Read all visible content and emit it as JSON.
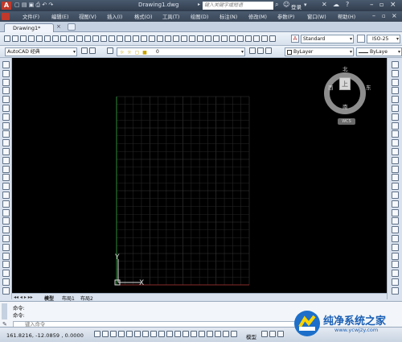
{
  "title": {
    "filename": "Drawing1.dwg",
    "search_placeholder": "键入关键字或短语",
    "login": "登录"
  },
  "menu": [
    "文件(F)",
    "编辑(E)",
    "视图(V)",
    "插入(I)",
    "格式(O)",
    "工具(T)",
    "绘图(D)",
    "标注(N)",
    "修改(M)",
    "参数(P)",
    "窗口(W)",
    "帮助(H)"
  ],
  "doc_tab": {
    "label": "Drawing1*"
  },
  "toolbar": {
    "text_style": "Standard",
    "dim_style": "ISO-25"
  },
  "toolbar2": {
    "workspace": "AutoCAD 经典",
    "layer": "0",
    "color": "ByLayer",
    "linetype": "ByLaye"
  },
  "viewcube": {
    "north": "北",
    "south": "南",
    "east": "东",
    "west": "西",
    "top": "上",
    "wcs": "WCS"
  },
  "ucs": {
    "y": "Y",
    "x": "X"
  },
  "layout_tabs": [
    "模型",
    "布局1",
    "布局2"
  ],
  "command": {
    "line1": "命令:",
    "line2": "命令:",
    "placeholder": "键入命令"
  },
  "status": {
    "coords": "161.8216,  -12.0859 , 0.0000",
    "model": "模型"
  },
  "watermark": {
    "title": "纯净系统之家",
    "url": "www.ycwjzy.com"
  }
}
